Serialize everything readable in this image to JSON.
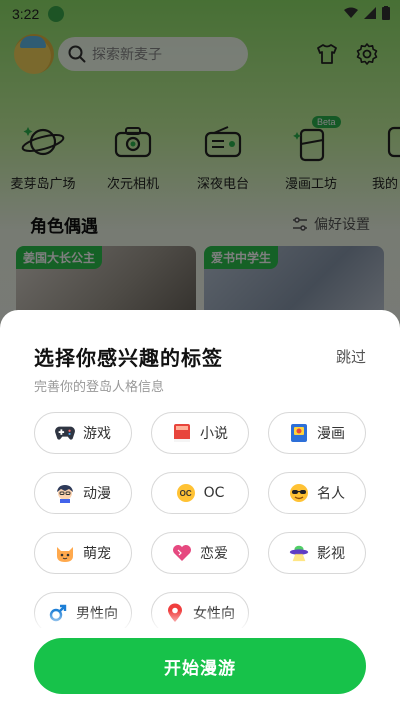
{
  "statusbar": {
    "time": "3:22"
  },
  "search": {
    "placeholder": "探索新麦子"
  },
  "nav": {
    "items": [
      {
        "label": "麦芽岛广场",
        "icon": "planet-icon"
      },
      {
        "label": "次元相机",
        "icon": "camera-icon"
      },
      {
        "label": "深夜电台",
        "icon": "radio-icon"
      },
      {
        "label": "漫画工坊",
        "icon": "comic-phone-icon",
        "badge": "Beta"
      },
      {
        "label": "我的",
        "icon": "more-icon"
      }
    ]
  },
  "section": {
    "title": "角色偶遇",
    "preference": "偏好设置"
  },
  "cards": [
    {
      "tag": "姜国大长公主"
    },
    {
      "tag": "爱书中学生"
    }
  ],
  "sheet": {
    "title": "选择你感兴趣的标签",
    "skip": "跳过",
    "subtitle": "完善你的登岛人格信息",
    "tags": [
      {
        "label": "游戏",
        "icon": "gamepad-icon"
      },
      {
        "label": "小说",
        "icon": "book-icon"
      },
      {
        "label": "漫画",
        "icon": "comic-book-icon"
      },
      {
        "label": "动漫",
        "icon": "anime-character-icon"
      },
      {
        "label": "OC",
        "icon": "oc-badge-icon",
        "icon_text": "OC"
      },
      {
        "label": "名人",
        "icon": "sunglasses-face-icon"
      },
      {
        "label": "萌宠",
        "icon": "cat-face-icon"
      },
      {
        "label": "恋爱",
        "icon": "heart-icon"
      },
      {
        "label": "影视",
        "icon": "ufo-icon"
      },
      {
        "label": "男性向",
        "icon": "male-symbol-icon"
      },
      {
        "label": "女性向",
        "icon": "location-pin-icon"
      }
    ],
    "start_button": "开始漫游"
  },
  "colors": {
    "accent": "#17c24a",
    "tag_badge": "#2bc24c"
  }
}
